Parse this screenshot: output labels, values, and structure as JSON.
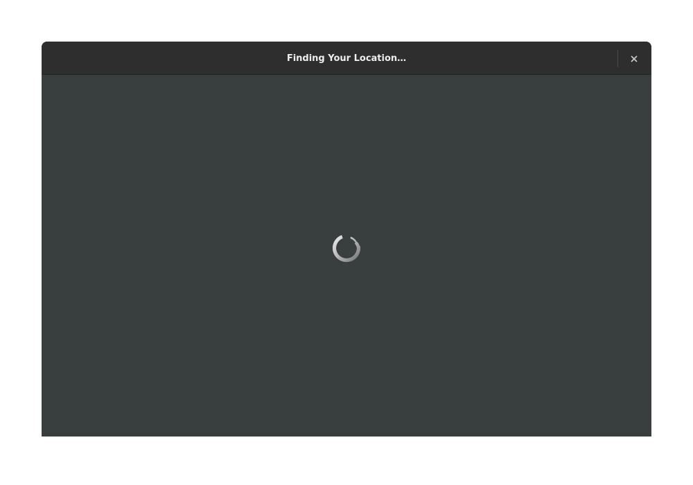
{
  "window": {
    "title": "Finding Your Location…",
    "close_icon": "close-icon",
    "spinner_icon": "loading-spinner-icon"
  },
  "colors": {
    "headerbar": "#2e2e2e",
    "content": "#393f3f",
    "title_text": "#eeeeec",
    "spinner": "#bdbdbd"
  }
}
